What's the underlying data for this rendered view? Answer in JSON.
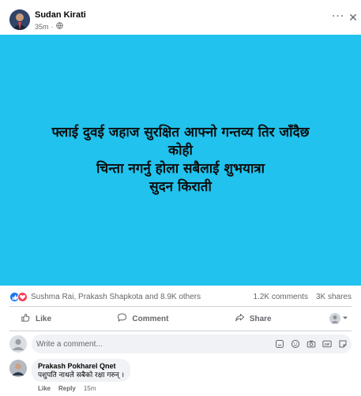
{
  "post": {
    "author": "Sudan Kirati",
    "time": "35m",
    "privacy_icon": "globe-icon",
    "banner_color": "#21c3ee",
    "text_lines": [
      "फ्लाई दुवई जहाज सुरक्षित आफ्नो गन्तव्य तिर जाँदैछ",
      "कोही",
      "चिन्ता नगर्नु होला सबैलाई शुभयात्रा",
      "सुदन किराती"
    ]
  },
  "reactions": {
    "names": "Sushma Rai, Prakash Shapkota and 8.9K others",
    "comments_count": "1.2K comments",
    "shares_count": "3K shares",
    "icons": [
      "like-icon",
      "love-icon"
    ]
  },
  "actions": {
    "like": "Like",
    "comment": "Comment",
    "share": "Share"
  },
  "comment_box": {
    "placeholder": "Write a comment..."
  },
  "comments": [
    {
      "author": "Prakash Pokharel Qnet",
      "text": "पशुपति नाथले सबैको रक्षा गरुन् ।",
      "like_label": "Like",
      "reply_label": "Reply",
      "time": "15m"
    }
  ]
}
